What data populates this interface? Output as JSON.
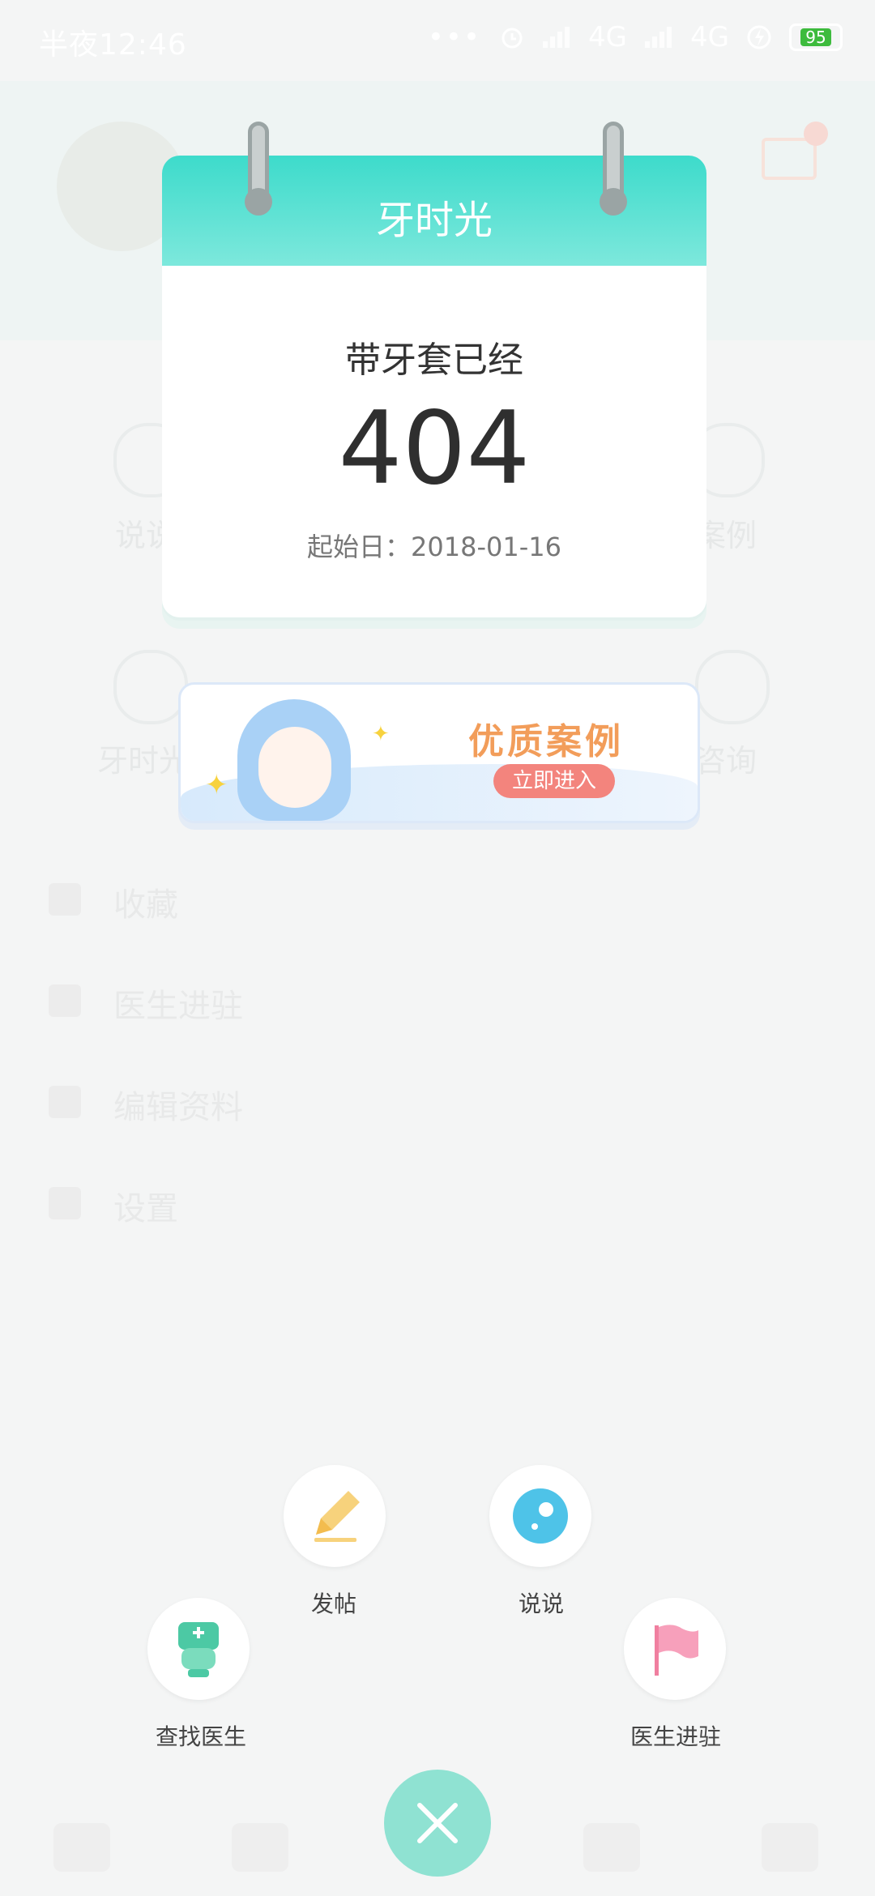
{
  "status_bar": {
    "time": "半夜12:46",
    "network1": "4G",
    "network2": "4G",
    "battery": "95"
  },
  "background": {
    "menu_items": [
      "收藏",
      "医生进驻",
      "编辑资料",
      "设置"
    ],
    "grid_labels": [
      "说说",
      "案例",
      "牙时光",
      "咨询"
    ]
  },
  "calendar": {
    "title": "牙时光",
    "label": "带牙套已经",
    "days": "404",
    "start_date": "起始日：2018-01-16"
  },
  "banner": {
    "title": "优质案例",
    "button": "立即进入"
  },
  "actions": {
    "post": {
      "label": "发帖",
      "icon": "pencil-icon"
    },
    "talk": {
      "label": "说说",
      "icon": "bubble-icon"
    },
    "find_doctor": {
      "label": "查找医生",
      "icon": "doctor-icon"
    },
    "doctor_join": {
      "label": "医生进驻",
      "icon": "flag-icon"
    }
  },
  "colors": {
    "accent": "#3ddbcb",
    "close_button": "#8fe2d2",
    "banner_title": "#f29d5a",
    "banner_button": "#f3847d"
  }
}
